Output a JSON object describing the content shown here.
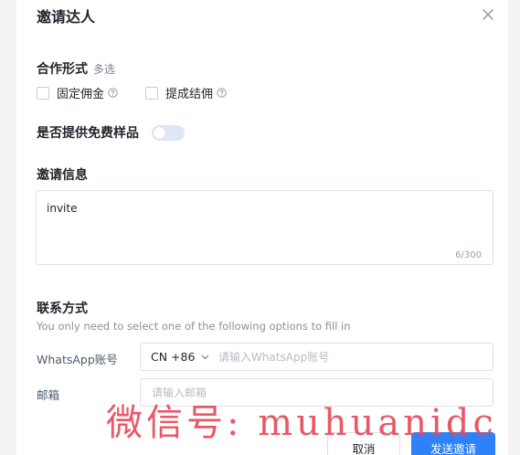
{
  "dialog": {
    "title": "邀请达人",
    "close_icon": "close-icon"
  },
  "cooperation": {
    "label": "合作形式",
    "note": "多选",
    "options": [
      {
        "label": "固定佣金",
        "checked": false
      },
      {
        "label": "提成结佣",
        "checked": false
      }
    ]
  },
  "free_sample": {
    "label": "是否提供免费样品",
    "enabled": false
  },
  "invite_info": {
    "label": "邀请信息",
    "value": "invite",
    "counter": "6/300"
  },
  "contact": {
    "label": "联系方式",
    "hint": "You only need to select one of the following options to fill in",
    "whatsapp": {
      "label": "WhatsApp账号",
      "country_code": "CN +86",
      "placeholder": "请输入WhatsApp账号"
    },
    "email": {
      "label": "邮箱",
      "placeholder": "请输入邮箱"
    }
  },
  "footer": {
    "cancel_label": "取消",
    "send_label": "发送邀请"
  },
  "watermark": "微信号: muhuanidc",
  "colors": {
    "primary": "#2f81f7",
    "toggle_off": "#dfe6f6",
    "watermark": "#e74b5b"
  }
}
